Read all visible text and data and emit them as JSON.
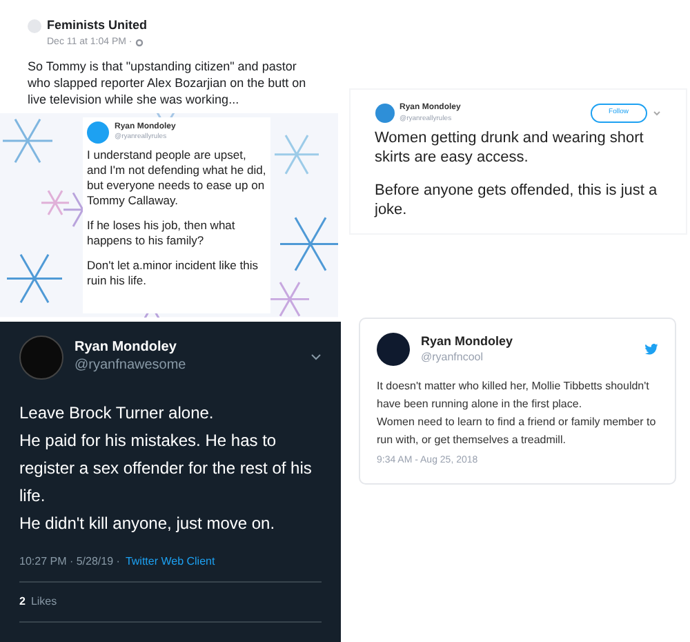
{
  "facebook_post": {
    "page_name": "Feminists United",
    "time": "Dec 11 at 1:04 PM ·",
    "text": "So Tommy is that \"upstanding citizen\" and pastor who slapped reporter Alex Bozarjian on the butt on live television while she was working..."
  },
  "tweets": [
    {
      "kind": "snow",
      "name": "Ryan Mondoley",
      "handle": "@ryanreallyrules",
      "lines": [
        "I understand people are upset, and I'm not defending what he did, but everyone needs to ease up on Tommy Callaway.",
        "If he loses his job, then what happens to his family?",
        "Don't let a.minor incident like this ruin his life."
      ]
    },
    {
      "kind": "follow",
      "name": "Ryan Mondoley",
      "handle": "@ryanreallyrules",
      "follow_label": "Follow",
      "lines": [
        "Women getting drunk and wearing short skirts are easy access.",
        "Before anyone gets offended, this is just a joke."
      ]
    },
    {
      "kind": "dark",
      "name": "Ryan Mondoley",
      "handle": "@ryanfnawesome",
      "lines": [
        "Leave Brock Turner alone.",
        "He paid for his mistakes. He has to register a sex offender for the rest of his life.",
        "He didn't kill anyone, just move on."
      ],
      "time": "10:27 PM · 5/28/19 ·",
      "client": "Twitter Web Client",
      "likes_count": "2",
      "likes_label": "Likes"
    },
    {
      "kind": "embed",
      "name": "Ryan Mondoley",
      "handle": "@ryanfncool",
      "lines": [
        "It doesn't matter who killed her, Mollie Tibbetts shouldn't have been running alone in the first place.",
        "Women need to learn to find a friend or family member to run with, or get themselves a treadmill."
      ],
      "time": "9:34 AM - Aug 25, 2018"
    }
  ]
}
